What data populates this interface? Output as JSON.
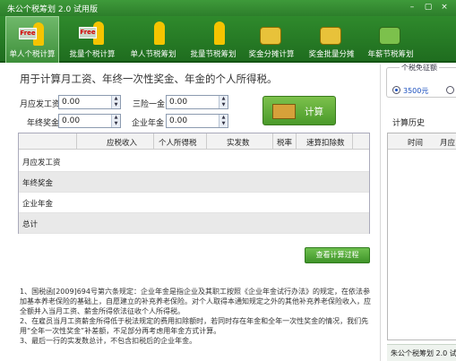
{
  "window": {
    "title": "朱公个税筹划 2.0 试用版",
    "controls": [
      "–",
      "▢",
      "×"
    ]
  },
  "toolbar": [
    {
      "label": "单人个税计算",
      "icon": "free-sign-person-icon",
      "sign": "Free",
      "active": true
    },
    {
      "label": "批量个税计算",
      "icon": "free-sign-person-icon",
      "sign": "Free",
      "active": false
    },
    {
      "label": "单人节税筹划",
      "icon": "person-icon",
      "sign": "",
      "active": false
    },
    {
      "label": "批量节税筹划",
      "icon": "person-icon",
      "sign": "",
      "active": false
    },
    {
      "label": "奖金分摊计算",
      "icon": "coins-icon",
      "sign": "",
      "active": false
    },
    {
      "label": "奖金批量分摊",
      "icon": "coins-icon",
      "sign": "",
      "active": false
    },
    {
      "label": "年薪节税筹划",
      "icon": "gift-icon",
      "sign": "",
      "active": false
    }
  ],
  "main": {
    "heading": "用于计算月工资、年终一次性奖金、年金的个人所得税。",
    "fields": {
      "monthly_salary": {
        "label": "月应发工资",
        "value": "0.00"
      },
      "three_insurances": {
        "label": "三险一金",
        "value": "0.00"
      },
      "year_end_bonus": {
        "label": "年终奖金",
        "value": "0.00"
      },
      "enterprise_annuity": {
        "label": "企业年金",
        "value": "0.00"
      }
    },
    "calc_button": "计算",
    "table": {
      "columns": [
        "",
        "应税收入",
        "个人所得税",
        "实发数",
        "税率",
        "速算扣除数"
      ],
      "rows": [
        "月应发工资",
        "年终奖金",
        "企业年金",
        "总计"
      ]
    },
    "process_button": "查看计算过程",
    "notes": [
      "1、国税函[2009]694号第六条规定：企业年金是指企业及其职工按照《企业年金试行办法》的规定，在依法参加基本养老保险的基础上，自愿建立的补充养老保险。对个人取得本通知规定之外的其他补充养老保险收入，应全额并入当月工资、薪金所得依法征收个人所得税。",
      "2、在雇员当月工资薪金所得低于税法规定的费用扣除额时，若同时存在年金和全年一次性奖金的情况，我们先用“全年一次性奖金”补差额，不足部分再考虑用年金方式计算。",
      "3、最后一行的实发数总计，不包含扣税后的企业年金。"
    ]
  },
  "right_panel": {
    "exemption_group_label": "个税免征额",
    "exemption_option": "3500元",
    "history_title": "计算历史",
    "history_columns": [
      "时间",
      "月应"
    ],
    "status_text": "朱公个税筹划 2.0 试用版"
  }
}
